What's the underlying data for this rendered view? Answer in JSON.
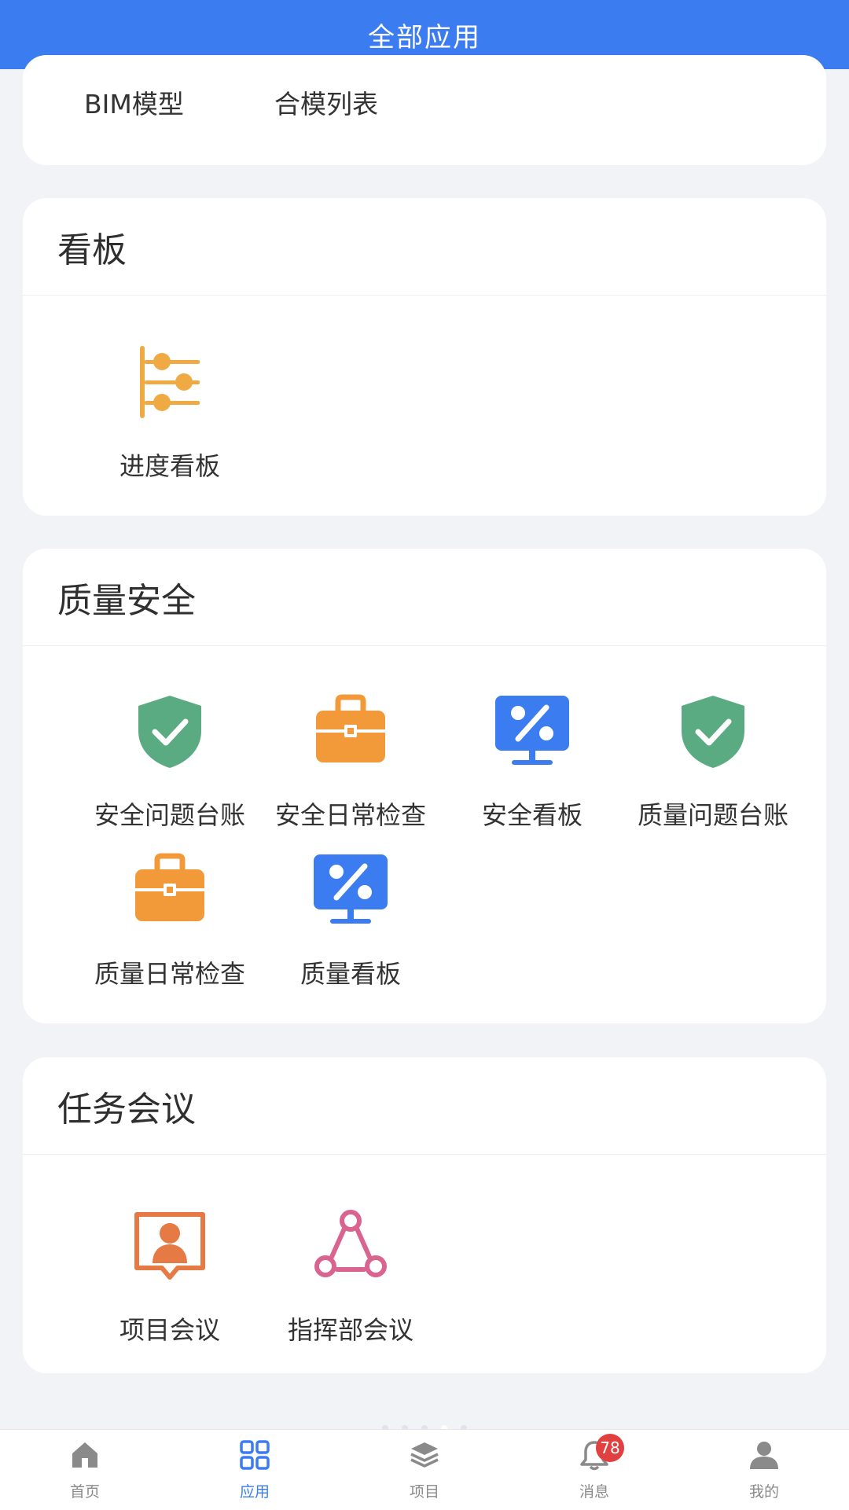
{
  "header": {
    "title": "全部应用"
  },
  "top_section": {
    "items": [
      {
        "label": "BIM模型"
      },
      {
        "label": "合模列表"
      }
    ]
  },
  "sections": [
    {
      "title": "看板",
      "items": [
        {
          "label": "进度看板",
          "icon": "progress-board-icon"
        }
      ]
    },
    {
      "title": "质量安全",
      "items": [
        {
          "label": "安全问题台账",
          "icon": "shield-check-icon"
        },
        {
          "label": "安全日常检查",
          "icon": "toolbox-icon"
        },
        {
          "label": "安全看板",
          "icon": "percent-monitor-icon"
        },
        {
          "label": "质量问题台账",
          "icon": "shield-check-icon"
        },
        {
          "label": "质量日常检查",
          "icon": "toolbox-icon"
        },
        {
          "label": "质量看板",
          "icon": "percent-monitor-icon"
        }
      ]
    },
    {
      "title": "任务会议",
      "items": [
        {
          "label": "项目会议",
          "icon": "presenter-icon"
        },
        {
          "label": "指挥部会议",
          "icon": "network-icon"
        }
      ]
    }
  ],
  "tabbar": {
    "tabs": [
      {
        "label": "首页",
        "icon": "home-icon"
      },
      {
        "label": "应用",
        "icon": "grid-icon",
        "active": true
      },
      {
        "label": "项目",
        "icon": "layers-icon"
      },
      {
        "label": "消息",
        "icon": "bell-icon"
      },
      {
        "label": "我的",
        "icon": "user-icon"
      }
    ],
    "message_badge": "78"
  },
  "colors": {
    "primary": "#3b7cf0",
    "green": "#5aaa82",
    "orange": "#f29a3a",
    "gold": "#efaa43",
    "coral": "#e57a45",
    "pink": "#d9648f",
    "background": "#f1f3f7"
  }
}
